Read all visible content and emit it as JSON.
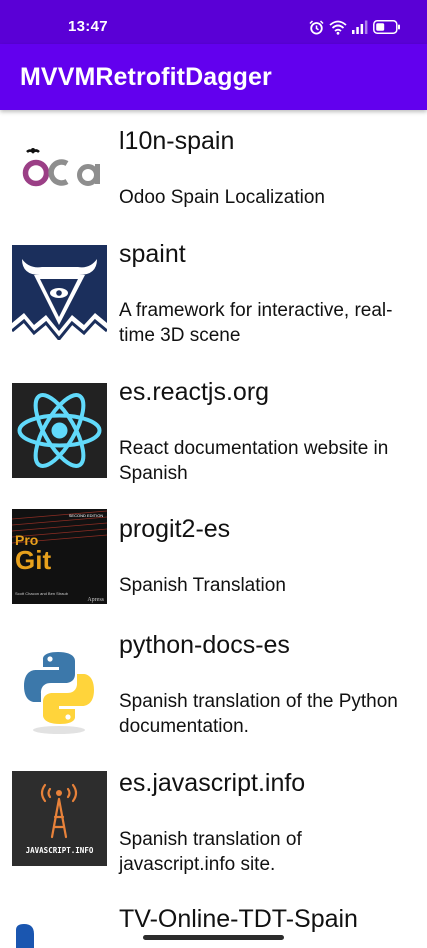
{
  "status_bar": {
    "time": "13:47",
    "icons": [
      "alarm-icon",
      "wifi-icon",
      "cellular-signal-icon",
      "battery-icon"
    ]
  },
  "app_bar": {
    "title": "MVVMRetrofitDagger"
  },
  "repos": [
    {
      "name": "l10n-spain",
      "description": "Odoo Spain Localization",
      "icon": "oca-logo"
    },
    {
      "name": "spaint",
      "description": "A framework for interactive, real-time 3D scene",
      "icon": "spaint-logo"
    },
    {
      "name": "es.reactjs.org",
      "description": "React documentation website in Spanish",
      "icon": "react-logo"
    },
    {
      "name": "progit2-es",
      "description": "Spanish Translation",
      "icon": "pro-git-book-cover"
    },
    {
      "name": "python-docs-es",
      "description": "Spanish translation of the Python documentation.",
      "icon": "python-logo"
    },
    {
      "name": "es.javascript.info",
      "description": "Spanish translation of javascript.info site.",
      "icon": "javascript-info-logo"
    },
    {
      "name": "TV-Online-TDT-Spain",
      "description": "",
      "icon": "tv-online-logo"
    }
  ],
  "oca_logo_text": "OCA",
  "progit_cover": {
    "title_pro": "Pro",
    "title_git": "Git",
    "edition": "SECOND EDITION",
    "authors": "Scott Chacon and Ben Straub",
    "publisher": "Apress"
  },
  "jsinfo_logo_text": "JAVASCRIPT.INFO",
  "colors": {
    "status_bar": "#5a00d6",
    "app_bar": "#6200ee",
    "react": "#61dafb"
  }
}
